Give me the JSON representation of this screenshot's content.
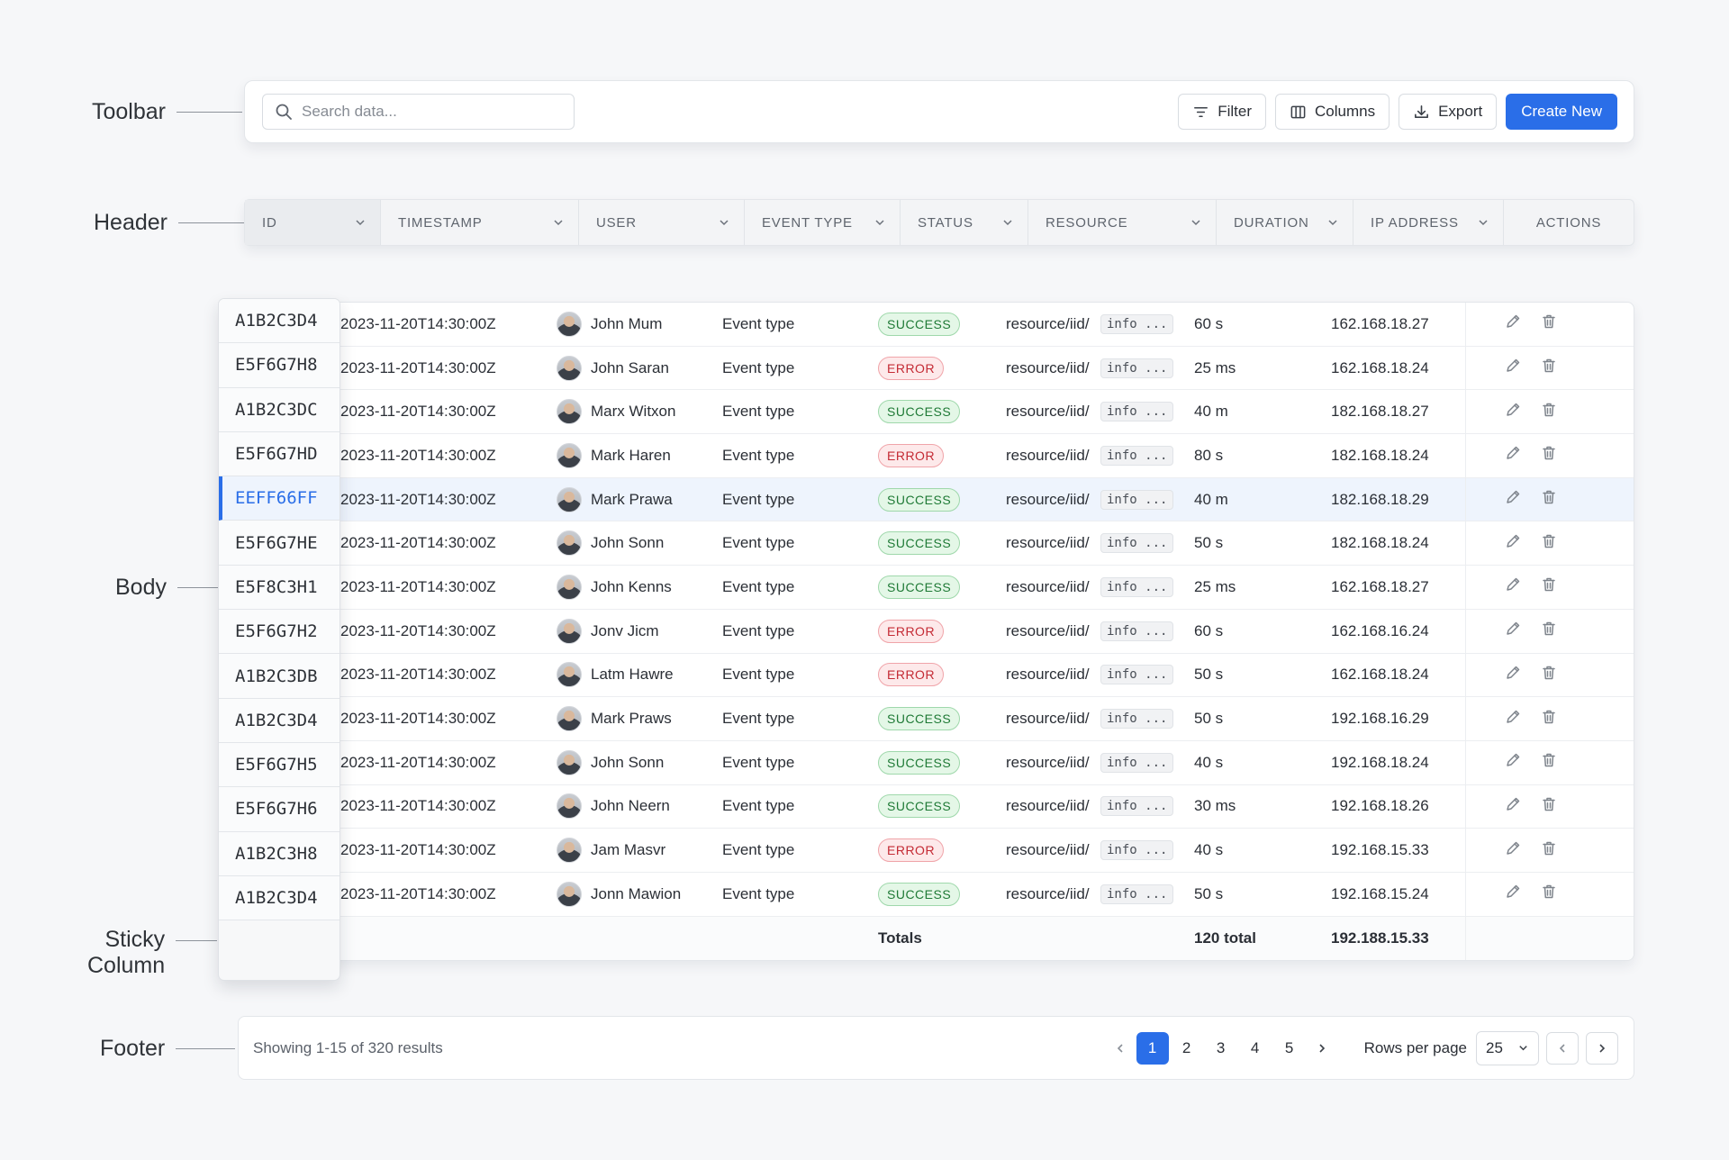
{
  "callouts": {
    "toolbar": "Toolbar",
    "header": "Header",
    "body": "Body",
    "sticky_line1": "Sticky",
    "sticky_line2": "Column",
    "footer": "Footer"
  },
  "toolbar": {
    "search_placeholder": "Search data...",
    "search_value": "",
    "filter_label": "Filter",
    "columns_label": "Columns",
    "export_label": "Export",
    "create_label": "Create New"
  },
  "columns": [
    "ID",
    "TIMESTAMP",
    "USER",
    "EVENT TYPE",
    "STATUS",
    "RESOURCE",
    "DURATION",
    "IP ADDRESS",
    "ACTIONS"
  ],
  "rows": [
    {
      "id": "A1B2C3D4",
      "ts": "2023-11-20T14:30:00Z",
      "user": "John Mum",
      "event": "Event type",
      "status": "SUCCESS",
      "resource": "resource/iid/",
      "info": "info ...",
      "duration": "60 s",
      "ip": "162.168.18.27"
    },
    {
      "id": "E5F6G7H8",
      "ts": "2023-11-20T14:30:00Z",
      "user": "John Saran",
      "event": "Event type",
      "status": "ERROR",
      "resource": "resource/iid/",
      "info": "info ...",
      "duration": "25 ms",
      "ip": "162.168.18.24"
    },
    {
      "id": "A1B2C3DC",
      "ts": "2023-11-20T14:30:00Z",
      "user": "Marx Witxon",
      "event": "Event type",
      "status": "SUCCESS",
      "resource": "resource/iid/",
      "info": "info ...",
      "duration": "40 m",
      "ip": "182.168.18.27"
    },
    {
      "id": "E5F6G7HD",
      "ts": "2023-11-20T14:30:00Z",
      "user": "Mark Haren",
      "event": "Event type",
      "status": "ERROR",
      "resource": "resource/iid/",
      "info": "info ...",
      "duration": "80 s",
      "ip": "182.168.18.24"
    },
    {
      "id": "EEFF66FF",
      "ts": "2023-11-20T14:30:00Z",
      "user": "Mark Prawa",
      "event": "Event type",
      "status": "SUCCESS",
      "resource": "resource/iid/",
      "info": "info ...",
      "duration": "40 m",
      "ip": "182.168.18.29",
      "selected": true
    },
    {
      "id": "E5F6G7HE",
      "ts": "2023-11-20T14:30:00Z",
      "user": "John Sonn",
      "event": "Event type",
      "status": "SUCCESS",
      "resource": "resource/iid/",
      "info": "info ...",
      "duration": "50 s",
      "ip": "182.168.18.24"
    },
    {
      "id": "E5F8C3H1",
      "ts": "2023-11-20T14:30:00Z",
      "user": "John Kenns",
      "event": "Event type",
      "status": "SUCCESS",
      "resource": "resource/iid/",
      "info": "info ...",
      "duration": "25 ms",
      "ip": "162.168.18.27"
    },
    {
      "id": "E5F6G7H2",
      "ts": "2023-11-20T14:30:00Z",
      "user": "Jonv Jicm",
      "event": "Event type",
      "status": "ERROR",
      "resource": "resource/iid/",
      "info": "info ...",
      "duration": "60 s",
      "ip": "162.168.16.24"
    },
    {
      "id": "A1B2C3DB",
      "ts": "2023-11-20T14:30:00Z",
      "user": "Latm Hawre",
      "event": "Event type",
      "status": "ERROR",
      "resource": "resource/iid/",
      "info": "info ...",
      "duration": "50 s",
      "ip": "162.168.18.24"
    },
    {
      "id": "A1B2C3D4",
      "ts": "2023-11-20T14:30:00Z",
      "user": "Mark Praws",
      "event": "Event type",
      "status": "SUCCESS",
      "resource": "resource/iid/",
      "info": "info ...",
      "duration": "50 s",
      "ip": "192.168.16.29"
    },
    {
      "id": "E5F6G7H5",
      "ts": "2023-11-20T14:30:00Z",
      "user": "John Sonn",
      "event": "Event type",
      "status": "SUCCESS",
      "resource": "resource/iid/",
      "info": "info ...",
      "duration": "40 s",
      "ip": "192.168.18.24"
    },
    {
      "id": "E5F6G7H6",
      "ts": "2023-11-20T14:30:00Z",
      "user": "John Neern",
      "event": "Event type",
      "status": "SUCCESS",
      "resource": "resource/iid/",
      "info": "info ...",
      "duration": "30 ms",
      "ip": "192.168.18.26"
    },
    {
      "id": "A1B2C3H8",
      "ts": "2023-11-20T14:30:00Z",
      "user": "Jam Masvr",
      "event": "Event type",
      "status": "ERROR",
      "resource": "resource/iid/",
      "info": "info ...",
      "duration": "40 s",
      "ip": "192.168.15.33"
    },
    {
      "id": "A1B2C3D4",
      "ts": "2023-11-20T14:30:00Z",
      "user": "Jonn Mawion",
      "event": "Event type",
      "status": "SUCCESS",
      "resource": "resource/iid/",
      "info": "info ...",
      "duration": "50 s",
      "ip": "192.168.15.24"
    }
  ],
  "totals": {
    "label": "Totals",
    "duration": "120 total",
    "ip": "192.188.15.33"
  },
  "footer": {
    "summary": "Showing 1-15 of 320 results",
    "pages": [
      "1",
      "2",
      "3",
      "4",
      "5"
    ],
    "active_page": "1",
    "rows_per_page_label": "Rows per page",
    "rows_per_page_value": "25"
  },
  "colors": {
    "accent": "#2a6ee8",
    "success": "#1f7a36",
    "error": "#c42a34"
  },
  "icons": {
    "search": "search-icon",
    "filter": "filter-icon",
    "columns": "columns-icon",
    "export": "download-icon",
    "sort": "chevron-down-icon",
    "edit": "pencil-icon",
    "delete": "trash-icon"
  }
}
